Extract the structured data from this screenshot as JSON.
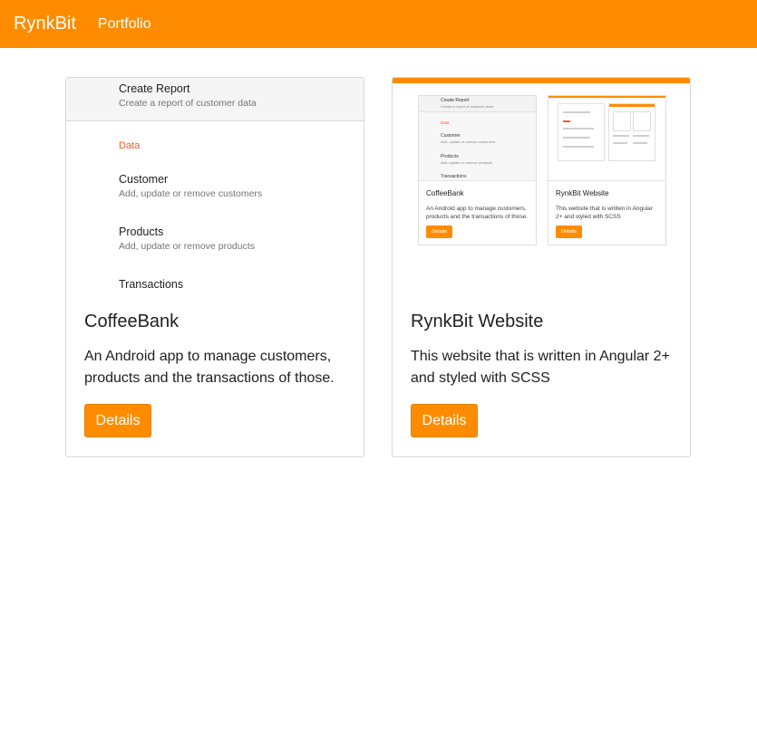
{
  "navbar": {
    "brand": "RynkBit",
    "link": "Portfolio"
  },
  "cards": [
    {
      "title": "CoffeeBank",
      "text": "An Android app to manage customers, products and the transactions of those.",
      "button": "Details",
      "screenshot": {
        "header": {
          "title": "Create Report",
          "subtitle": "Create a report of customer data"
        },
        "section": "Data",
        "items": [
          {
            "title": "Customer",
            "subtitle": "Add, update or remove customers"
          },
          {
            "title": "Products",
            "subtitle": "Add, update or remove products"
          },
          {
            "title": "Transactions",
            "subtitle": ""
          }
        ]
      }
    },
    {
      "title": "RynkBit Website",
      "text": "This website that is written in Angular 2+ and styled with SCSS",
      "button": "Details",
      "screenshot": {
        "cards": [
          {
            "title": "CoffeeBank",
            "text": "An Android app to manage customers, products and the transactions of those.",
            "button": "Details",
            "top_title": "Create Report",
            "top_subtitle": "Create a report of customer data",
            "top_section": "Data",
            "top_items": [
              "Customer",
              "Products",
              "Transactions"
            ],
            "top_item_subs": [
              "Add, update or remove customers",
              "Add, update or remove products"
            ]
          },
          {
            "title": "RynkBit Website",
            "text": "This website that is written in Angular 2+ and styled with SCSS",
            "button": "Details"
          }
        ]
      }
    }
  ],
  "colors": {
    "primary": "#ff8c00",
    "section": "#ff5722"
  }
}
